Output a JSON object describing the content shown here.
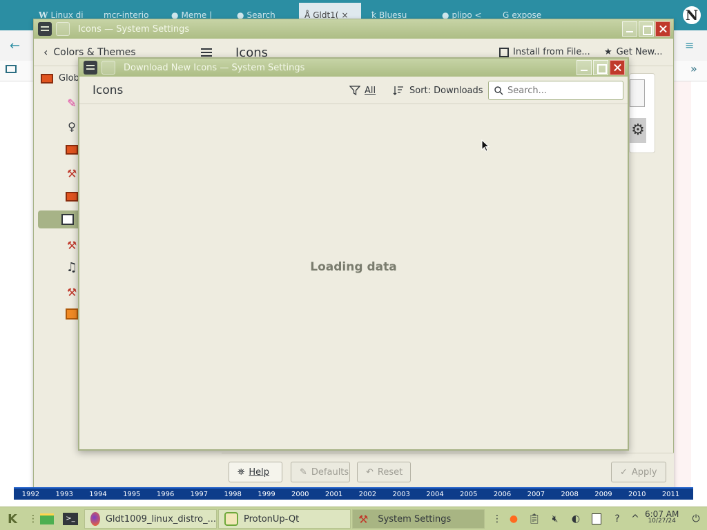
{
  "browser": {
    "tabs": [
      "Linux di",
      "mcr-interio",
      "Meme |",
      "Search",
      "Gldt1(",
      "Bluesu",
      "plipo <",
      "expose"
    ]
  },
  "timeline": [
    "1992",
    "1993",
    "1994",
    "1995",
    "1996",
    "1997",
    "1998",
    "1999",
    "2000",
    "2001",
    "2002",
    "2003",
    "2004",
    "2005",
    "2006",
    "2007",
    "2008",
    "2009",
    "2010",
    "2011"
  ],
  "settings_window": {
    "title": "Icons — System Settings",
    "back_label": "Colors & Themes",
    "page_title": "Icons",
    "install_from_file": "Install from File...",
    "get_new": "Get New...",
    "sidebar_global": "Glob",
    "buttons": {
      "help": "Help",
      "defaults": "Defaults",
      "reset": "Reset",
      "apply": "Apply"
    }
  },
  "dialog": {
    "title": "Download New Icons — System Settings",
    "header": "Icons",
    "filter_label": "All",
    "sort_label": "Sort: Downloads",
    "search_placeholder": "Search...",
    "loading": "Loading data"
  },
  "taskbar": {
    "tasks": [
      "Gldt1009_linux_distro_...",
      "ProtonUp-Qt",
      "System Settings"
    ],
    "time": "6:07 AM",
    "date": "10/27/24"
  },
  "colors": {
    "accent": "#a7b387",
    "titlebar": "#b5c38e",
    "taskbar": "#c5d39c",
    "timeline": "#0d3c8a"
  }
}
